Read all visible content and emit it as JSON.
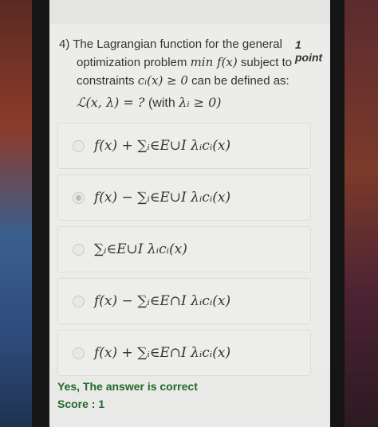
{
  "question": {
    "number": "4)",
    "line1": "The Lagrangian function for the general",
    "line2_text": "optimization problem",
    "line2_math": "min f(x)",
    "line2_tail": "subject to",
    "line3_text": "constraints",
    "line3_math": "cᵢ(x) ≥ 0",
    "line3_tail": "can be defined as:",
    "formula_math": "ℒ(x, λ) = ?",
    "formula_tail": "(with",
    "formula_cond": "λᵢ ≥ 0)",
    "points": "1 point"
  },
  "options": [
    {
      "label": "f(x) + ∑ᵢ∈E∪I λᵢcᵢ(x)",
      "selected": false
    },
    {
      "label": "f(x) − ∑ᵢ∈E∪I λᵢcᵢ(x)",
      "selected": true
    },
    {
      "label": "∑ᵢ∈E∪I λᵢcᵢ(x)",
      "selected": false
    },
    {
      "label": "f(x) − ∑ᵢ∈E∩I λᵢcᵢ(x)",
      "selected": false
    },
    {
      "label": "f(x) + ∑ᵢ∈E∩I λᵢcᵢ(x)",
      "selected": false
    }
  ],
  "feedback": {
    "result": "Yes, The answer is correct",
    "score": "Score : 1"
  }
}
